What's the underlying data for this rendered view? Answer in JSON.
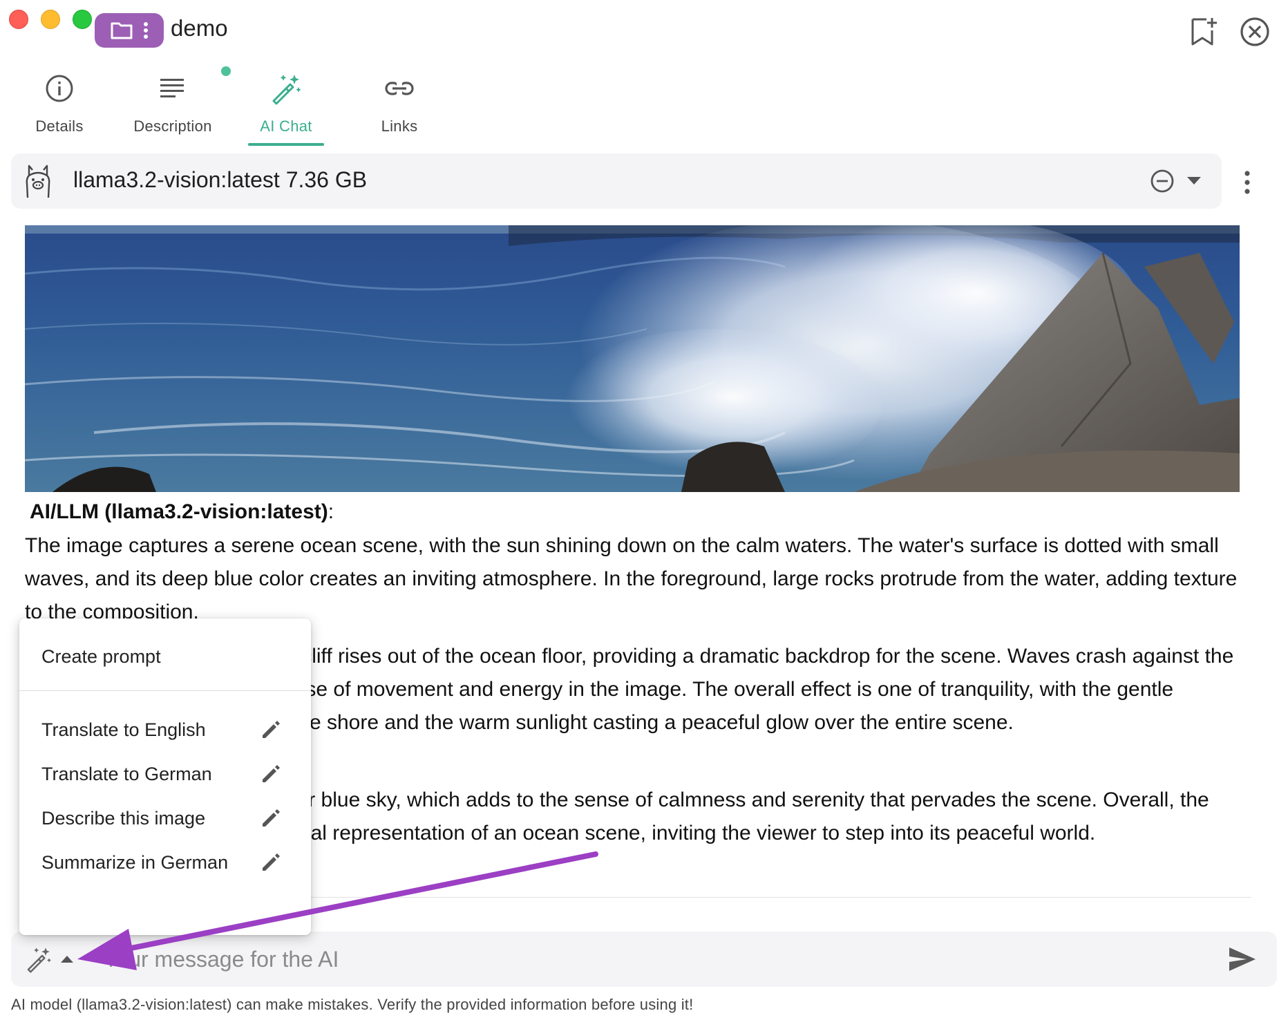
{
  "window": {
    "title": "demo",
    "folder_color": "#9c5fb5"
  },
  "tabs": [
    {
      "label": "Details",
      "icon": "info-icon"
    },
    {
      "label": "Description",
      "icon": "description-icon"
    },
    {
      "label": "AI Chat",
      "icon": "magic-wand-icon",
      "active": true
    },
    {
      "label": "Links",
      "icon": "link-icon"
    }
  ],
  "model": {
    "label": "llama3.2-vision:latest 7.36 GB",
    "icon": "llama-icon"
  },
  "response": {
    "heading": "AI/LLM (llama3.2-vision:latest)",
    "heading_suffix": ":",
    "p1": "The image captures a serene ocean scene, with the sun shining down on the calm waters. The water's surface is dotted with small waves, and its deep blue color creates an inviting atmosphere. In the foreground, large rocks protrude from the water, adding texture to the composition.",
    "p2": "In the background, a massive cliff rises out of the ocean floor, providing a dramatic backdrop for the scene. Waves crash against the base of the cliff, creating a sense of movement and energy in the image. The overall effect is one of tranquility, with the gentle lapping of the waves against the shore and the warm sunlight casting a peaceful glow over the entire scene.",
    "p3": "The image also features a clear blue sky, which adds to the sense of calmness and serenity that pervades the scene. Overall, the image presents a stunning visual representation of an ocean scene, inviting the viewer to step into its peaceful world."
  },
  "menu": {
    "items": [
      {
        "label": "Create prompt"
      },
      {
        "label": "Translate to English"
      },
      {
        "label": "Translate to German"
      },
      {
        "label": "Describe this image"
      },
      {
        "label": "Summarize in German"
      }
    ]
  },
  "input": {
    "placeholder": "Your message for the AI",
    "value": ""
  },
  "footer": {
    "note": "AI model (llama3.2-vision:latest) can make mistakes. Verify the provided information before using it!"
  },
  "colors": {
    "accent": "#3bae8e",
    "annotation_arrow": "#9b3fc4"
  }
}
